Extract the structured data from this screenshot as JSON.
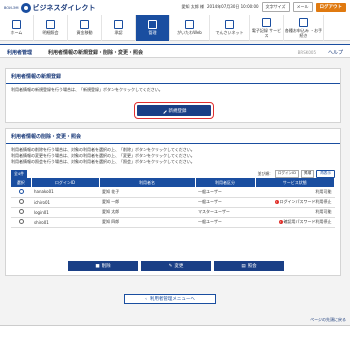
{
  "header": {
    "bank_small": "ВОИ-ЭМ",
    "brand": "ビジネスダイレクト",
    "user": "愛知 太郎 様",
    "login_time": "2014年07月30日 10:00:00",
    "font_size_label": "文字サイズ",
    "mail_label": "メール",
    "logout_label": "ログアウト"
  },
  "nav": [
    {
      "label": "ホーム",
      "icon": "home-icon"
    },
    {
      "label": "明細照会",
      "icon": "statement-icon"
    },
    {
      "label": "資金移動",
      "icon": "transfer-icon"
    },
    {
      "label": "承認",
      "icon": "approval-icon"
    },
    {
      "label": "管理",
      "icon": "admin-icon",
      "active": true
    },
    {
      "label": "がいたわWeb",
      "icon": "web-icon"
    },
    {
      "label": "でんさいネット",
      "icon": "densai-icon"
    },
    {
      "label": "電子記録\nサービス",
      "icon": "record-icon"
    },
    {
      "label": "各種お申込み\n・お手続き",
      "icon": "application-icon"
    }
  ],
  "titlebar": {
    "section": "利用者管理",
    "title": "利用者情報の新規登録・削除・変更・照会",
    "screen_code": "BRSK005",
    "help": "ヘルプ"
  },
  "new_reg": {
    "heading": "利用者情報の新規登録",
    "desc": "利用者情報の新規登録を行う場合は、「新規登録」ボタンをクリックしてください。",
    "button": "新規登録"
  },
  "manage": {
    "heading": "利用者情報の削除・変更・照会",
    "desc_lines": [
      "利用者情報の削除を行う場合は、対象の利用者を選択の上、「削除」ボタンをクリックしてください。",
      "利用者情報の変更を行う場合は、対象の利用者を選択の上、「変更」ボタンをクリックしてください。",
      "利用者情報の照会を行う場合は、対象の利用者を選択の上、「照会」ボタンをクリックしてください。"
    ],
    "count": "全4件",
    "sort_label": "並び順：",
    "sort_field": "ログインID",
    "sort_order": "昇順",
    "resort": "再表示",
    "columns": [
      "選択",
      "ログインID",
      "利用者名",
      "利用者区分",
      "サービス状態"
    ],
    "rows": [
      {
        "id": "hanako01",
        "name": "愛知 花子",
        "type": "一般ユーザー",
        "status": "利用可能",
        "warn": false,
        "selected": true
      },
      {
        "id": "ichiro01",
        "name": "愛知 一郎",
        "type": "一般ユーザー",
        "status": "ログインパスワード利用停止",
        "warn": true,
        "selected": false
      },
      {
        "id": "login01",
        "name": "愛知 太郎",
        "type": "マスターユーザー",
        "status": "利用可能",
        "warn": false,
        "selected": false
      },
      {
        "id": "shiro01",
        "name": "愛知 四郎",
        "type": "一般ユーザー",
        "status": "確認用パスワード利用停止",
        "warn": true,
        "selected": false
      }
    ],
    "btn_delete": "削除",
    "btn_change": "変更",
    "btn_view": "照会"
  },
  "back_button": "利用者管理メニューへ",
  "page_top": "ページの先頭に戻る",
  "colors": {
    "primary": "#1a4ea0",
    "accent": "#e07a10",
    "highlight": "#e03030"
  }
}
